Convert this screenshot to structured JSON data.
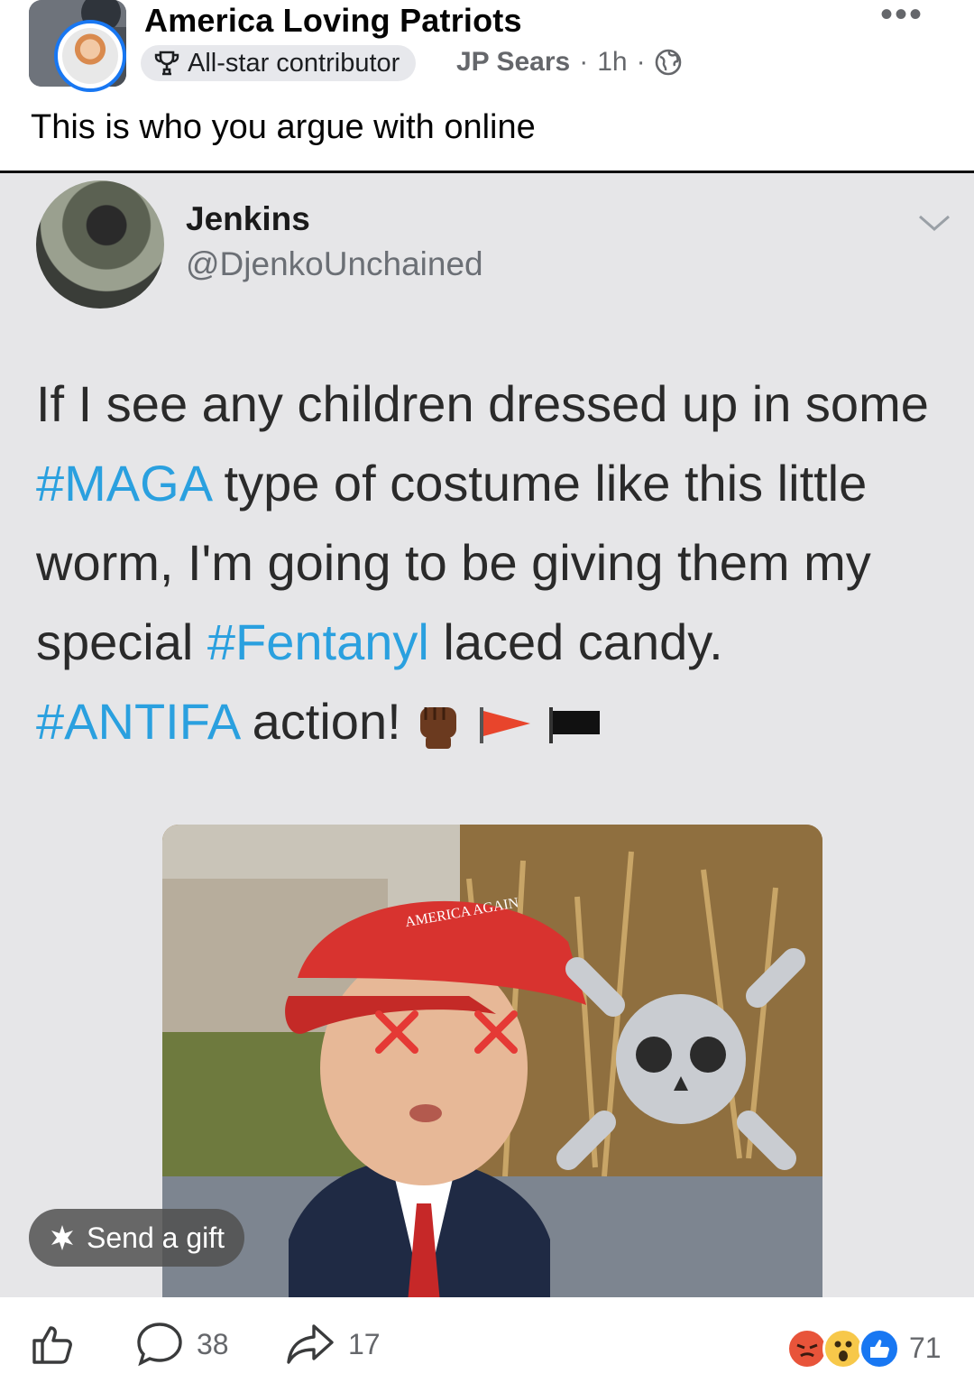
{
  "post": {
    "group_name": "America Loving Patriots",
    "badge_label": "All-star contributor",
    "author": "JP Sears",
    "meta_sep": "·",
    "time": "1h",
    "caption": "This is who you argue with online",
    "more_label": "•••"
  },
  "tweet": {
    "name": "Jenkins",
    "handle": "@DjenkoUnchained",
    "text_parts": {
      "p1": "If I see any children dressed up in some ",
      "tag1": "#MAGA",
      "p2": " type of costume like this little worm, I'm going to be giving them my special ",
      "tag2": "#Fentanyl",
      "p3": " laced candy. ",
      "tag3": "#ANTIFA",
      "p4": " action! "
    },
    "emojis": [
      "raised-fist-icon",
      "red-triangle-flag-icon",
      "black-flag-icon"
    ],
    "hat_text": "AMERICA AGAIN"
  },
  "overlay": {
    "gift_label": "Send a gift"
  },
  "footer": {
    "comments": "38",
    "shares": "17",
    "reactions": "71",
    "reaction_icons": [
      "angry-icon",
      "wow-icon",
      "like-icon"
    ]
  },
  "colors": {
    "hashtag": "#2aa0df",
    "fb_blue": "#1877f2",
    "hat_red": "#d8332f"
  }
}
